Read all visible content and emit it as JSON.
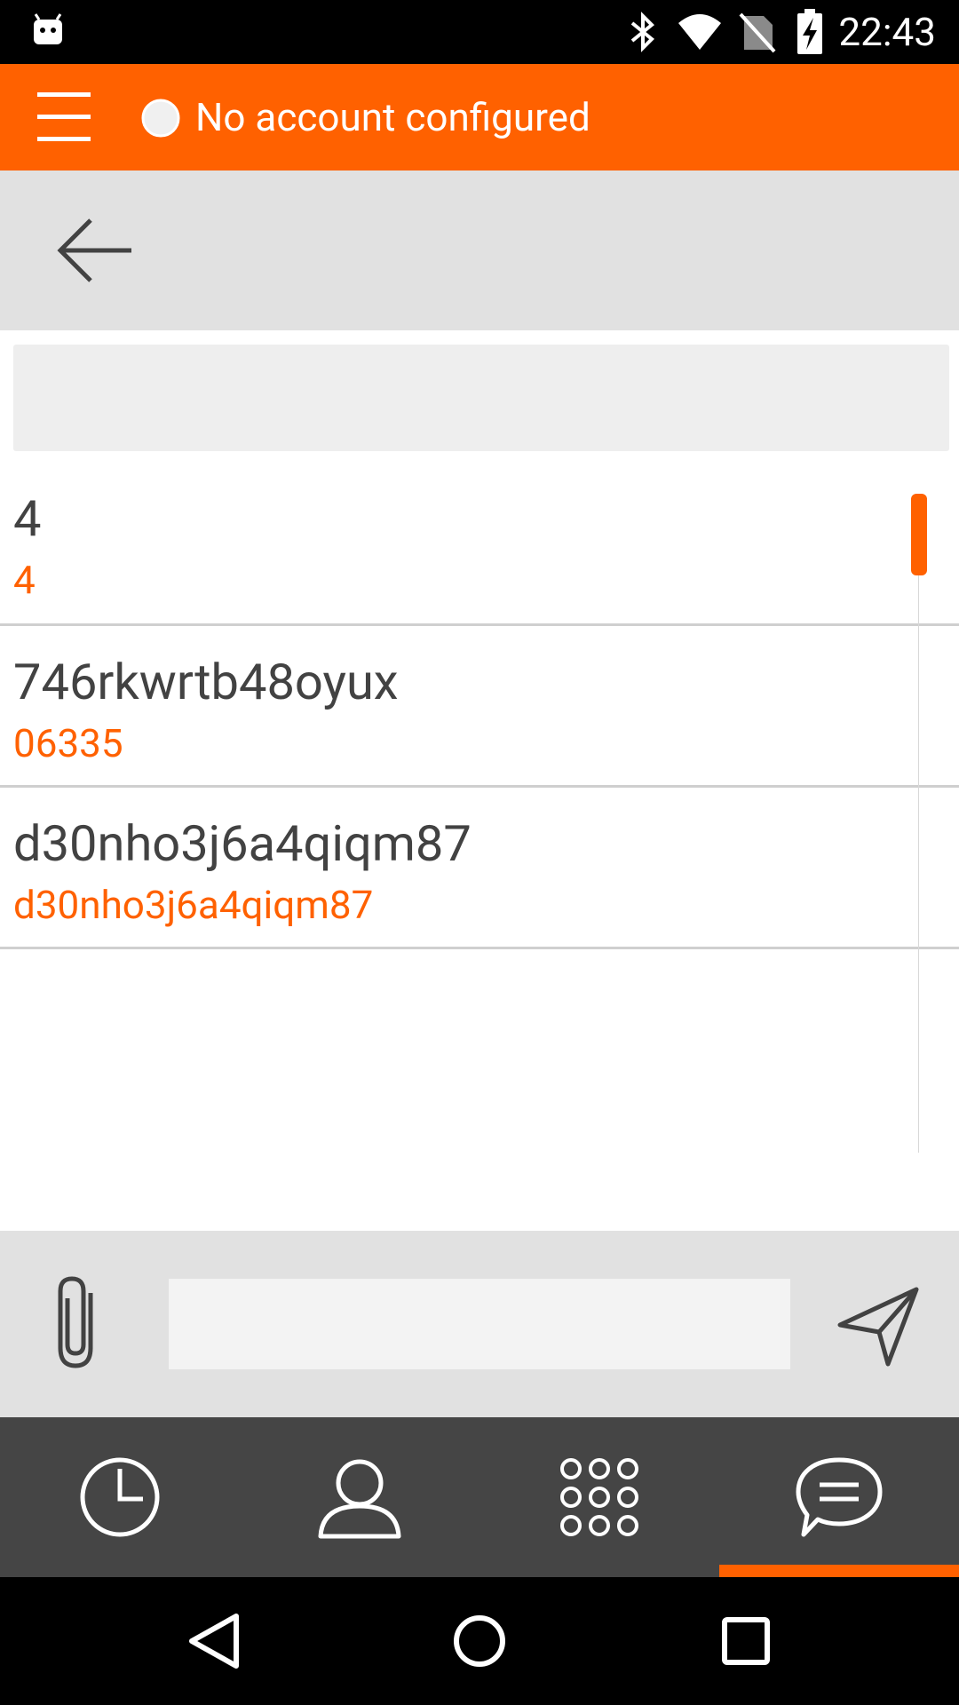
{
  "status_bar": {
    "time": "22:43"
  },
  "app_bar": {
    "account_status": "No account configured"
  },
  "search": {
    "placeholder": ""
  },
  "contacts": [
    {
      "name": "4",
      "number": "4"
    },
    {
      "name": "746rkwrtb48oyux",
      "number": "06335"
    },
    {
      "name": "d30nho3j6a4qiqm87",
      "number": "d30nho3j6a4qiqm87"
    }
  ],
  "compose": {
    "placeholder": ""
  },
  "tabs": [
    {
      "id": "history",
      "icon": "clock-icon"
    },
    {
      "id": "contacts",
      "icon": "person-icon"
    },
    {
      "id": "dialpad",
      "icon": "dialpad-icon"
    },
    {
      "id": "chat",
      "icon": "chat-icon",
      "selected": true
    }
  ],
  "colors": {
    "accent": "#ff6100",
    "toolbar": "#e1e1e1",
    "tabbar": "#454545"
  }
}
